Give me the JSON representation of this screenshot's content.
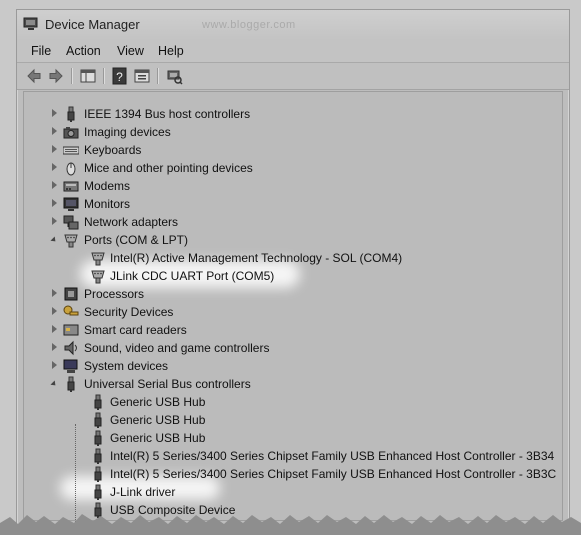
{
  "window": {
    "title": "Device Manager",
    "ghost_text": "www.blogger.com"
  },
  "menu": [
    "File",
    "Action",
    "View",
    "Help"
  ],
  "toolbar": [
    {
      "name": "back-button",
      "icon": "arrow-left-icon"
    },
    {
      "name": "forward-button",
      "icon": "arrow-right-icon"
    },
    {
      "name": "show-hide-console-tree-button",
      "icon": "console-tree-icon"
    },
    {
      "name": "help-button",
      "icon": "help-icon"
    },
    {
      "name": "properties-button",
      "icon": "properties-icon"
    },
    {
      "name": "scan-hardware-button",
      "icon": "scan-hardware-icon"
    }
  ],
  "tree": [
    {
      "label": "IEEE 1394 Bus host controllers",
      "state": "collapsed",
      "icon": "usb-plug-icon"
    },
    {
      "label": "Imaging devices",
      "state": "collapsed",
      "icon": "camera-icon"
    },
    {
      "label": "Keyboards",
      "state": "collapsed",
      "icon": "keyboard-icon"
    },
    {
      "label": "Mice and other pointing devices",
      "state": "collapsed",
      "icon": "mouse-icon"
    },
    {
      "label": "Modems",
      "state": "collapsed",
      "icon": "modem-icon"
    },
    {
      "label": "Monitors",
      "state": "collapsed",
      "icon": "monitor-icon"
    },
    {
      "label": "Network adapters",
      "state": "collapsed",
      "icon": "network-icon"
    },
    {
      "label": "Ports (COM & LPT)",
      "state": "expanded",
      "icon": "port-icon",
      "children": [
        {
          "label": "Intel(R) Active Management Technology - SOL (COM4)",
          "icon": "port-icon"
        },
        {
          "label": "JLink CDC UART Port (COM5)",
          "icon": "port-icon",
          "highlight": true
        }
      ]
    },
    {
      "label": "Processors",
      "state": "collapsed",
      "icon": "processor-icon"
    },
    {
      "label": "Security Devices",
      "state": "collapsed",
      "icon": "security-key-icon"
    },
    {
      "label": "Smart card readers",
      "state": "collapsed",
      "icon": "smart-card-icon"
    },
    {
      "label": "Sound, video and game controllers",
      "state": "collapsed",
      "icon": "speaker-icon"
    },
    {
      "label": "System devices",
      "state": "collapsed",
      "icon": "computer-icon"
    },
    {
      "label": "Universal Serial Bus controllers",
      "state": "expanded",
      "icon": "usb-plug-icon",
      "children": [
        {
          "label": "Generic USB Hub",
          "icon": "usb-plug-icon"
        },
        {
          "label": "Generic USB Hub",
          "icon": "usb-plug-icon"
        },
        {
          "label": "Generic USB Hub",
          "icon": "usb-plug-icon"
        },
        {
          "label": "Intel(R) 5 Series/3400 Series Chipset Family USB Enhanced Host Controller - 3B34",
          "icon": "usb-plug-icon"
        },
        {
          "label": "Intel(R) 5 Series/3400 Series Chipset Family USB Enhanced Host Controller - 3B3C",
          "icon": "usb-plug-icon"
        },
        {
          "label": "J-Link driver",
          "icon": "usb-plug-icon",
          "highlight": true
        },
        {
          "label": "USB Composite Device",
          "icon": "usb-plug-icon"
        }
      ]
    }
  ]
}
